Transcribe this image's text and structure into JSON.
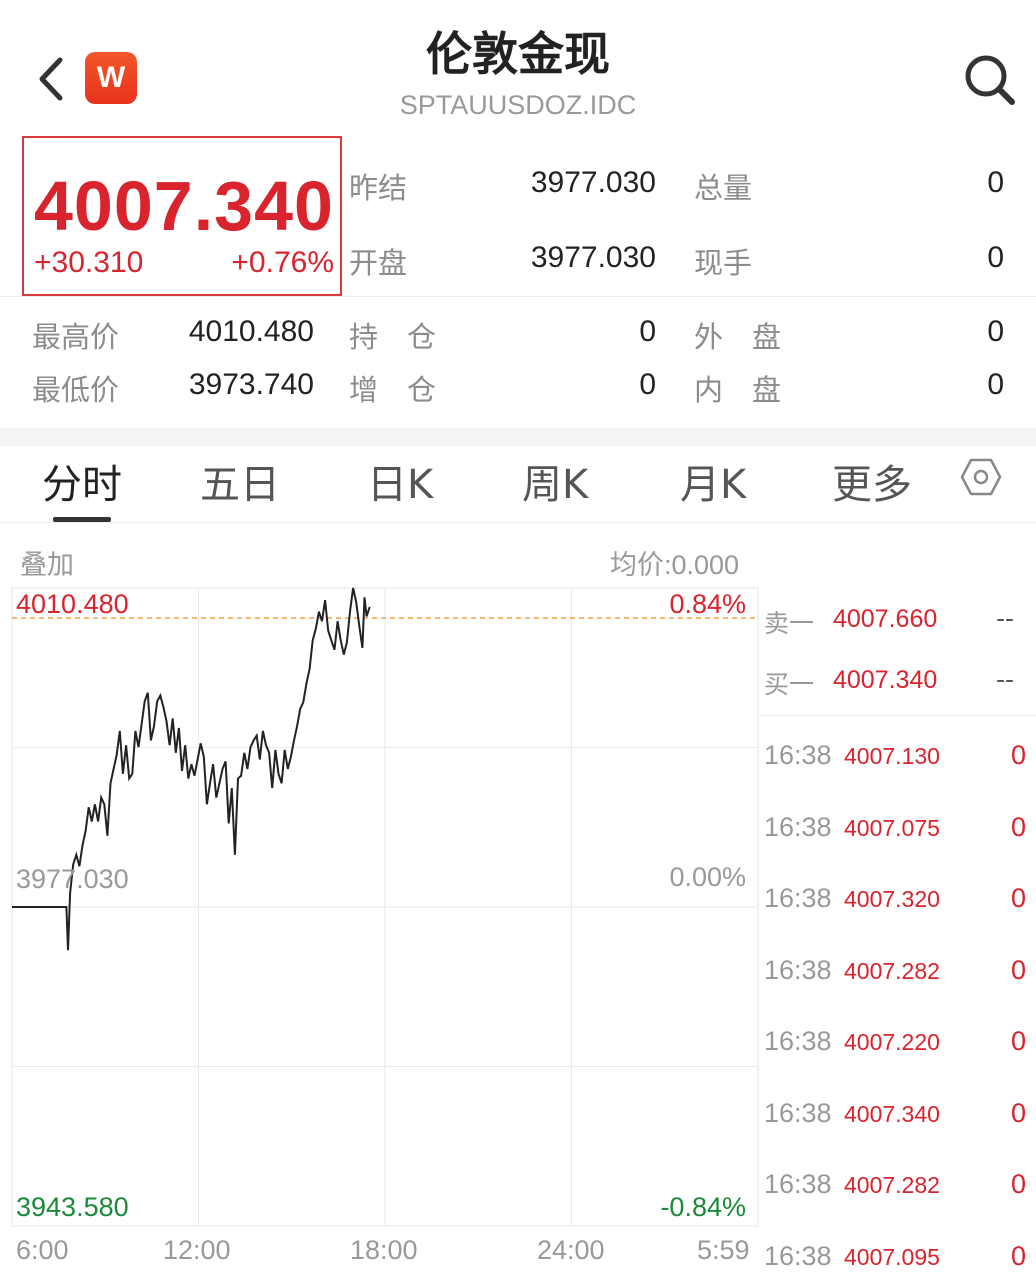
{
  "header": {
    "title": "伦敦金现",
    "subtitle": "SPTAUUSDOZ.IDC",
    "logo_letter": "W"
  },
  "quote": {
    "price": "4007.340",
    "change": "+30.310",
    "change_pct": "+0.76%",
    "prev_settle_label": "昨结",
    "prev_settle": "3977.030",
    "open_label": "开盘",
    "open": "3977.030",
    "total_vol_label": "总量",
    "total_vol": "0",
    "cur_hand_label": "现手",
    "cur_hand": "0",
    "high_label": "最高价",
    "high": "4010.480",
    "low_label": "最低价",
    "low": "3973.740",
    "hold_label": "持　仓",
    "hold": "0",
    "add_label": "增　仓",
    "add": "0",
    "outer_label": "外　盘",
    "outer": "0",
    "inner_label": "内　盘",
    "inner": "0"
  },
  "tabs": [
    "分时",
    "五日",
    "日K",
    "周K",
    "月K",
    "更多"
  ],
  "chart_labels": {
    "overlay": "叠加",
    "avg_price": "均价:0.000"
  },
  "orderbook": {
    "sell_label": "卖一",
    "sell_price": "4007.660",
    "sell_vol": "--",
    "buy_label": "买一",
    "buy_price": "4007.340",
    "buy_vol": "--"
  },
  "ticks": [
    {
      "time": "16:38",
      "price": "4007.130",
      "vol": "0"
    },
    {
      "time": "16:38",
      "price": "4007.075",
      "vol": "0"
    },
    {
      "time": "16:38",
      "price": "4007.320",
      "vol": "0"
    },
    {
      "time": "16:38",
      "price": "4007.282",
      "vol": "0"
    },
    {
      "time": "16:38",
      "price": "4007.220",
      "vol": "0"
    },
    {
      "time": "16:38",
      "price": "4007.340",
      "vol": "0"
    },
    {
      "time": "16:38",
      "price": "4007.282",
      "vol": "0"
    },
    {
      "time": "16:38",
      "price": "4007.095",
      "vol": "0"
    }
  ],
  "colors": {
    "up": "#d9232d",
    "down": "#1a8a3a",
    "ref_line": "#f0a040"
  },
  "chart_data": {
    "type": "line",
    "y_axis_left": [
      "4010.480",
      "3977.030",
      "3943.580"
    ],
    "y_axis_right": [
      "0.84%",
      "0.00%",
      "-0.84%"
    ],
    "x_ticks": [
      "6:00",
      "12:00",
      "18:00",
      "24:00",
      "5:59"
    ],
    "ylim": [
      3943.58,
      4010.48
    ],
    "prev_close": 3977.03,
    "x_minutes_max": 1439,
    "grid": true,
    "series": [
      {
        "points": [
          [
            0,
            3977.03
          ],
          [
            105,
            3977.03
          ],
          [
            108,
            3972.5
          ],
          [
            112,
            3978.5
          ],
          [
            118,
            3981.5
          ],
          [
            124,
            3982.5
          ],
          [
            130,
            3981.3
          ],
          [
            136,
            3983.5
          ],
          [
            142,
            3985.0
          ],
          [
            148,
            3987.5
          ],
          [
            154,
            3986.0
          ],
          [
            160,
            3987.8
          ],
          [
            166,
            3986.0
          ],
          [
            172,
            3988.5
          ],
          [
            178,
            3987.8
          ],
          [
            184,
            3984.5
          ],
          [
            190,
            3990.0
          ],
          [
            196,
            3991.5
          ],
          [
            202,
            3993.0
          ],
          [
            208,
            3995.5
          ],
          [
            214,
            3991.0
          ],
          [
            220,
            3994.0
          ],
          [
            226,
            3990.5
          ],
          [
            232,
            3991.0
          ],
          [
            238,
            3995.5
          ],
          [
            244,
            3993.8
          ],
          [
            250,
            3996.2
          ],
          [
            256,
            3998.6
          ],
          [
            262,
            3999.5
          ],
          [
            268,
            3994.5
          ],
          [
            274,
            3996.0
          ],
          [
            280,
            3998.6
          ],
          [
            286,
            3999.2
          ],
          [
            292,
            3998.0
          ],
          [
            298,
            3996.5
          ],
          [
            304,
            3994.0
          ],
          [
            310,
            3996.8
          ],
          [
            316,
            3993.2
          ],
          [
            322,
            3995.8
          ],
          [
            328,
            3991.3
          ],
          [
            334,
            3994.0
          ],
          [
            340,
            3990.5
          ],
          [
            346,
            3992.0
          ],
          [
            352,
            3990.8
          ],
          [
            358,
            3992.5
          ],
          [
            364,
            3994.2
          ],
          [
            370,
            3992.8
          ],
          [
            376,
            3987.8
          ],
          [
            382,
            3990.0
          ],
          [
            388,
            3992.0
          ],
          [
            394,
            3988.5
          ],
          [
            400,
            3990.0
          ],
          [
            406,
            3991.5
          ],
          [
            412,
            3992.3
          ],
          [
            418,
            3985.8
          ],
          [
            424,
            3989.5
          ],
          [
            430,
            3982.5
          ],
          [
            436,
            3990.5
          ],
          [
            442,
            3990.8
          ],
          [
            448,
            3993.2
          ],
          [
            454,
            3991.5
          ],
          [
            460,
            3993.8
          ],
          [
            466,
            3994.5
          ],
          [
            472,
            3995.0
          ],
          [
            478,
            3992.5
          ],
          [
            484,
            3995.5
          ],
          [
            490,
            3994.0
          ],
          [
            496,
            3993.2
          ],
          [
            502,
            3989.5
          ],
          [
            508,
            3993.5
          ],
          [
            514,
            3991.0
          ],
          [
            520,
            3990.0
          ],
          [
            526,
            3993.5
          ],
          [
            532,
            3991.5
          ],
          [
            538,
            3992.8
          ],
          [
            544,
            3994.5
          ],
          [
            550,
            3996.0
          ],
          [
            556,
            3997.8
          ],
          [
            562,
            3998.5
          ],
          [
            568,
            4000.5
          ],
          [
            574,
            4002.0
          ],
          [
            580,
            4005.0
          ],
          [
            586,
            4006.2
          ],
          [
            592,
            4008.0
          ],
          [
            598,
            4007.0
          ],
          [
            604,
            4009.2
          ],
          [
            610,
            4006.0
          ],
          [
            616,
            4005.0
          ],
          [
            622,
            4004.0
          ],
          [
            628,
            4007.0
          ],
          [
            634,
            4005.0
          ],
          [
            640,
            4003.5
          ],
          [
            646,
            4004.8
          ],
          [
            652,
            4008.0
          ],
          [
            658,
            4010.48
          ],
          [
            664,
            4009.0
          ],
          [
            670,
            4006.5
          ],
          [
            676,
            4004.2
          ],
          [
            680,
            4009.5
          ],
          [
            684,
            4007.5
          ],
          [
            690,
            4008.5
          ]
        ]
      }
    ]
  }
}
